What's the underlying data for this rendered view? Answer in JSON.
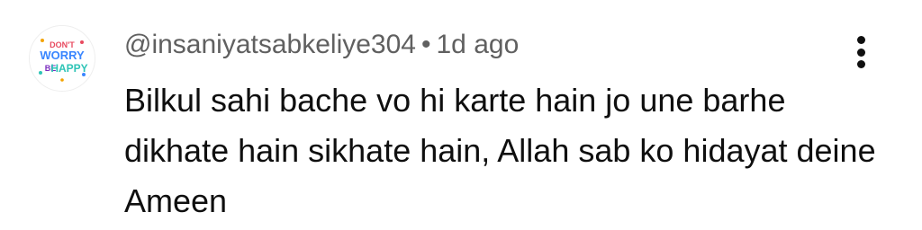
{
  "comment": {
    "avatar": {
      "icon": "dont-worry-be-happy-avatar-icon",
      "lines": [
        "DON'T",
        "WORRY",
        "BE HAPPY"
      ],
      "colors": [
        "#e84a5f",
        "#f4a300",
        "#2ec4b6",
        "#7b2cbf",
        "#3a86ff"
      ]
    },
    "author": "@insaniyatsabkeliye304",
    "separator": "•",
    "time": "1d ago",
    "text": "Bilkul sahi bache vo hi karte hain jo une barhe dikhate hain sikhate hain, Allah sab ko hidayat deine Ameen",
    "menu_icon": "more-vert-icon"
  }
}
